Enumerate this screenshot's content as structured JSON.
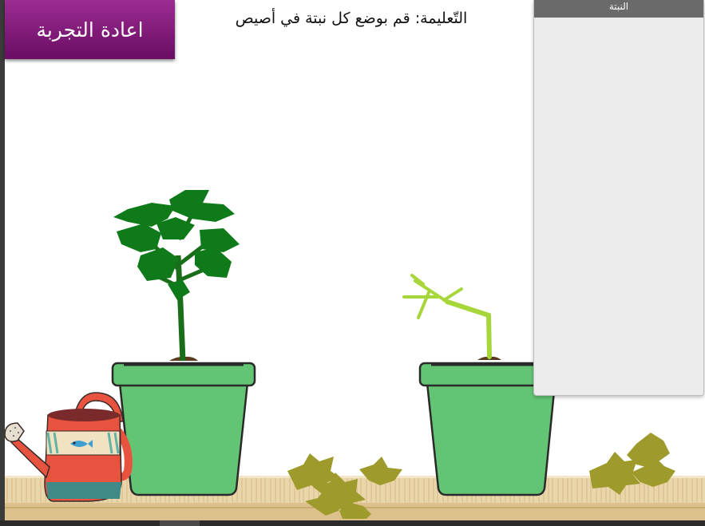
{
  "reset_button": {
    "label": "اعادة التجربة"
  },
  "instruction": {
    "text": "التّعليمة: قم بوضع كل نبتة في أصيص"
  },
  "plant_panel": {
    "title": "النبتة"
  },
  "colors": {
    "reset_button": "#7d1a75",
    "pot": "#63c574",
    "healthy_leaves": "#0f7a1a",
    "pale_sprout": "#a6d63a",
    "fallen_leaves": "#9e9a2c",
    "shelf": "#e8d2a5",
    "watering_can": "#e8533f"
  },
  "icons": [
    "watering-can-icon"
  ]
}
